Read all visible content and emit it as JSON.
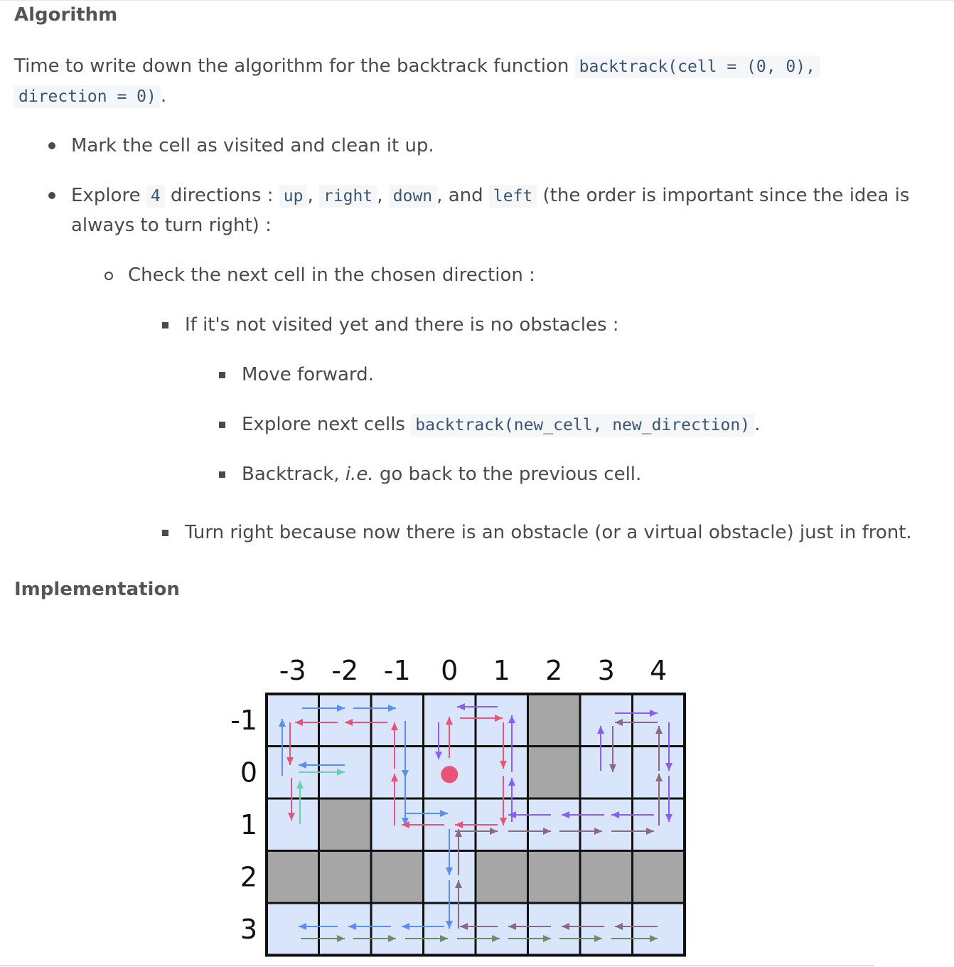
{
  "algorithm": {
    "heading": "Algorithm",
    "intro_text": "Time to write down the algorithm for the backtrack function",
    "intro_code_1": "backtrack(cell = (0, 0),",
    "intro_code_2": "direction = 0)",
    "intro_end": ".",
    "bullet_1": "Mark the cell as visited and clean it up.",
    "bullet_2": {
      "prefix": "Explore",
      "count": "4",
      "mid": "directions :",
      "dirs": [
        "up",
        "right",
        "down",
        "left"
      ],
      "and": "and",
      "comma": ",",
      "tail_1": "(the order is important since the idea is",
      "tail_2": "always to turn right) :"
    },
    "sub_1": "Check the next cell in the chosen direction :",
    "sub_2": "If it's not visited yet and there is no obstacles :",
    "sub_3": "Move forward.",
    "sub_4_text": "Explore next cells",
    "sub_4_code": "backtrack(new_cell, new_direction)",
    "sub_4_end": ".",
    "sub_5_pre": "Backtrack,",
    "sub_5_ie": "i.e.",
    "sub_5_post": "go back to the previous cell.",
    "sub_6": "Turn right because now there is an obstacle (or a virtual obstacle) just in front."
  },
  "implementation": {
    "heading": "Implementation"
  },
  "grid": {
    "col_labels": [
      "-3",
      "-2",
      "-1",
      "0",
      "1",
      "2",
      "3",
      "4"
    ],
    "row_labels": [
      "-1",
      "0",
      "1",
      "2",
      "3"
    ],
    "obstacles": [
      [
        "2",
        "-1"
      ],
      [
        "2",
        "0"
      ],
      [
        "-2",
        "1"
      ],
      [
        "-3",
        "2"
      ],
      [
        "-2",
        "2"
      ],
      [
        "-1",
        "2"
      ],
      [
        "1",
        "2"
      ],
      [
        "2",
        "2"
      ],
      [
        "3",
        "2"
      ],
      [
        "4",
        "2"
      ]
    ],
    "start": [
      "0",
      "0"
    ],
    "colors": {
      "free_cell": "#d8e5fb",
      "obstacle": "#a6a6a6",
      "start_dot": "#e8537a",
      "blue": "#5b8ef0",
      "pink": "#e8537a",
      "purple": "#8d5cf0",
      "mauve": "#8a6a82",
      "teal": "#6ccfae",
      "green": "#6a8f68"
    }
  }
}
